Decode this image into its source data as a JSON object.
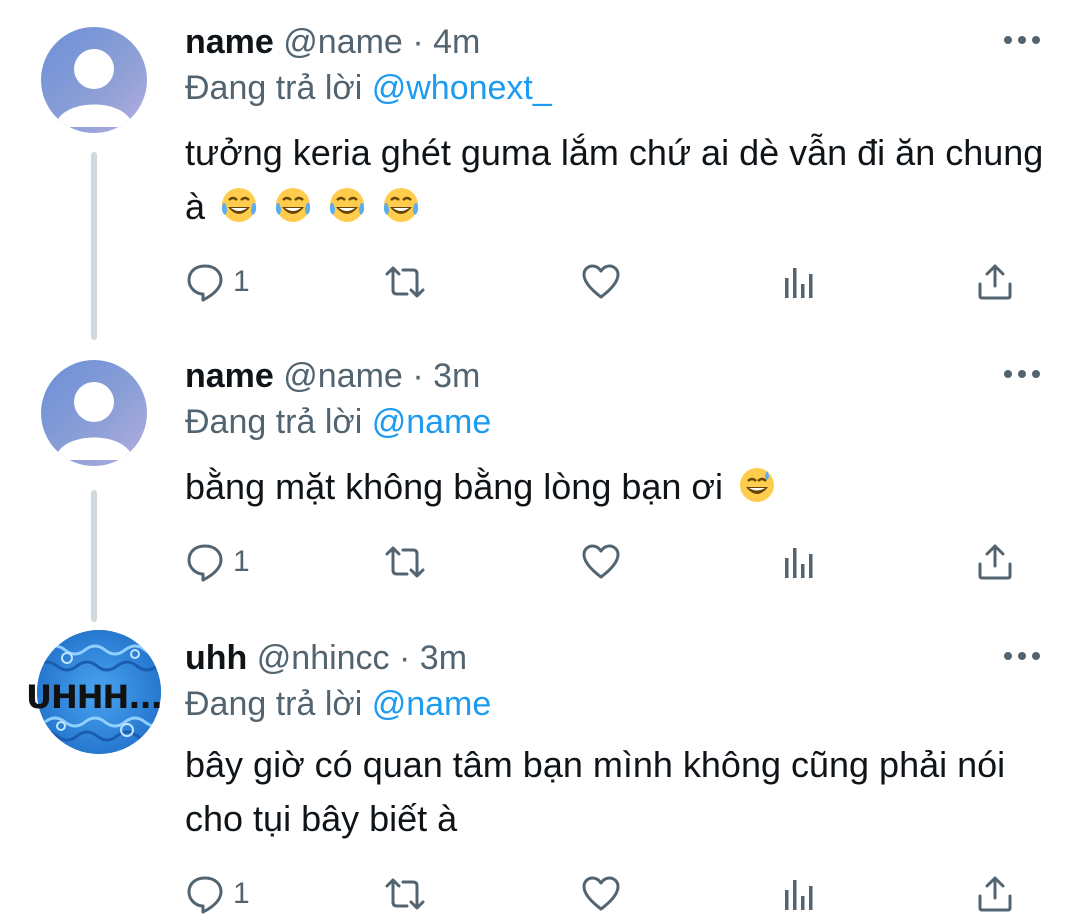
{
  "tweets": [
    {
      "name": "name",
      "handle": "@name",
      "dot": "·",
      "time": "4m",
      "reply_prefix": "Đang trả lời",
      "reply_to": "@whonext_",
      "body_line1": "tưởng keria ghét guma lắm chứ ai dè vẫn đi ăn chung",
      "body_line2": "à",
      "body_emoji": "tears-of-joy-emoji x4",
      "reply_count": "1",
      "avatar": "default-avatar"
    },
    {
      "name": "name",
      "handle": "@name",
      "dot": "·",
      "time": "3m",
      "reply_prefix": "Đang trả lời",
      "reply_to": "@name",
      "body_line1": "bằng mặt không bằng lòng bạn ơi",
      "body_emoji": "grinning-sweat-emoji",
      "reply_count": "1",
      "avatar": "default-avatar"
    },
    {
      "name": "uhh",
      "handle": "@nhincc",
      "dot": "·",
      "time": "3m",
      "reply_prefix": "Đang trả lời",
      "reply_to": "@name",
      "body_line1": "bây giờ có quan tâm bạn mình không cũng phải nói",
      "body_line2": "cho tụi bây biết à",
      "reply_count": "1",
      "avatar": "uhh-avatar",
      "avatar_text": "UHHH..."
    }
  ],
  "icons": {
    "reply": "reply-icon",
    "retweet": "retweet-icon",
    "like": "heart-icon",
    "views": "views-icon",
    "share": "share-icon",
    "more": "more-icon"
  },
  "colors": {
    "text": "#0f1419",
    "secondary": "#536471",
    "mention": "#1d9bf0",
    "thread_line": "#cfd9de"
  }
}
